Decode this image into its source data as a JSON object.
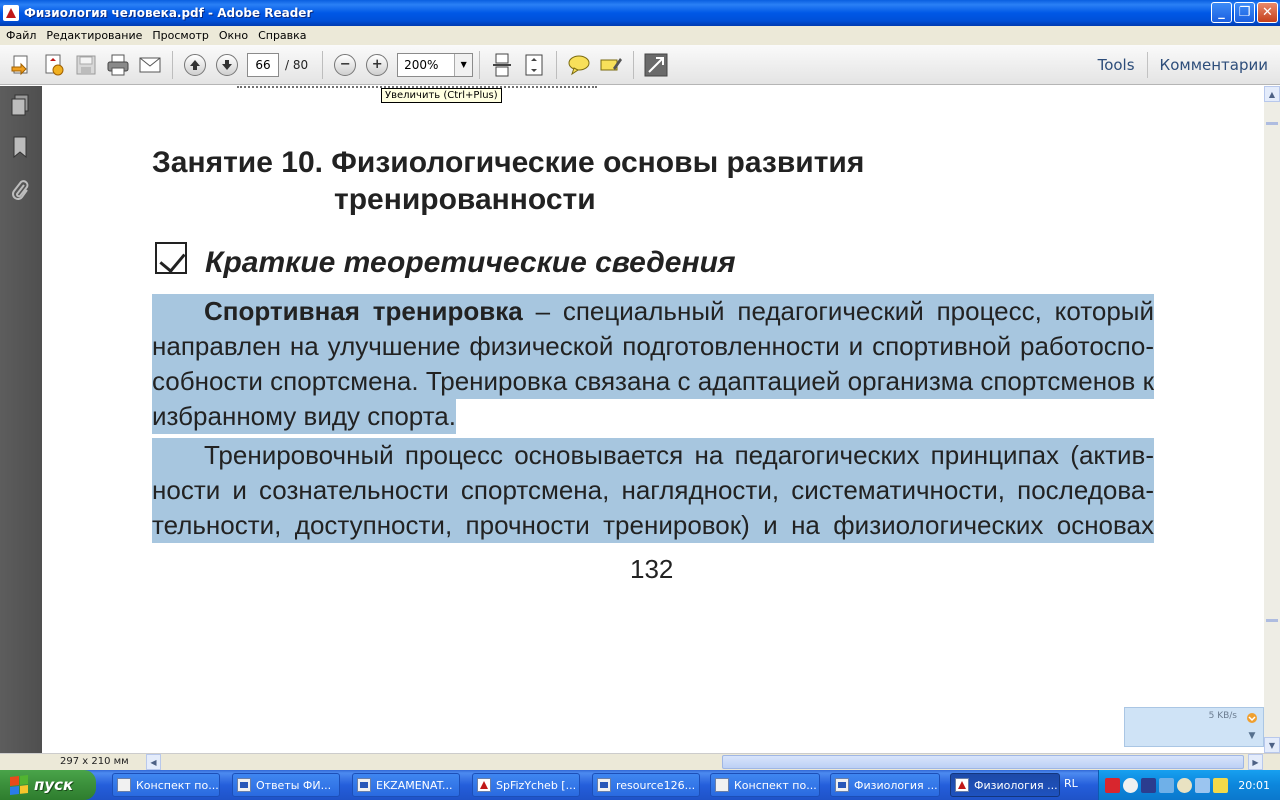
{
  "window": {
    "title": "Физиология человека.pdf - Adobe Reader",
    "minimize": "_",
    "maximize": "❐",
    "close": "✕"
  },
  "menu": [
    "Файл",
    "Редактирование",
    "Просмотр",
    "Окно",
    "Справка"
  ],
  "toolbar": {
    "page_current": "66",
    "page_total": "/ 80",
    "zoom_minus": "−",
    "zoom_plus": "+",
    "zoom_value": "200%",
    "zoom_dropdown": "▼",
    "tools_label": "Tools",
    "comments_label": "Комментарии"
  },
  "tooltip": "Увеличить (Ctrl+Plus)",
  "document": {
    "heading_line1": "Занятие 10. Физиологические основы развития",
    "heading_line2": "тренированности",
    "subheading": "Краткие теоретические сведения",
    "p1": {
      "bold": "Спортивная тренировка",
      "rest1": " – специальный педагогический процесс, который",
      "line2": "направлен на улучшение физической подготовленности и спортивной работоспо-",
      "line3": "собности спортсмена. Тренировка связана с адаптацией организма спортсменов к",
      "line4": "избранному виду спорта."
    },
    "p2": {
      "line1": "Тренировочный процесс основывается на педагогических принципах (актив-",
      "line2": "ности и сознательности спортсмена, наглядности, систематичности, последова-",
      "line3": "тельности, доступности, прочности тренировок) и на физиологических основах"
    },
    "page_number": "132"
  },
  "status": {
    "page_size": "297 x 210 мм"
  },
  "net_widget": {
    "speed": "5 KB/s"
  },
  "taskbar": {
    "start_label": "пуск",
    "tasks": [
      {
        "label": "Конспект по...",
        "icon": "app-window-icon"
      },
      {
        "label": "Ответы ФИ...",
        "icon": "word-doc-icon"
      },
      {
        "label": "EKZAMENAT...",
        "icon": "word-doc-icon"
      },
      {
        "label": "SpFizYcheb [...",
        "icon": "pdf-doc-icon"
      },
      {
        "label": "resource126...",
        "icon": "word-doc-icon"
      },
      {
        "label": "Конспект по...",
        "icon": "app-window-icon"
      },
      {
        "label": "Физиология ...",
        "icon": "word-doc-icon"
      },
      {
        "label": "Физиология ...",
        "icon": "pdf-doc-icon"
      }
    ],
    "language": "RL",
    "clock": "20:01"
  }
}
